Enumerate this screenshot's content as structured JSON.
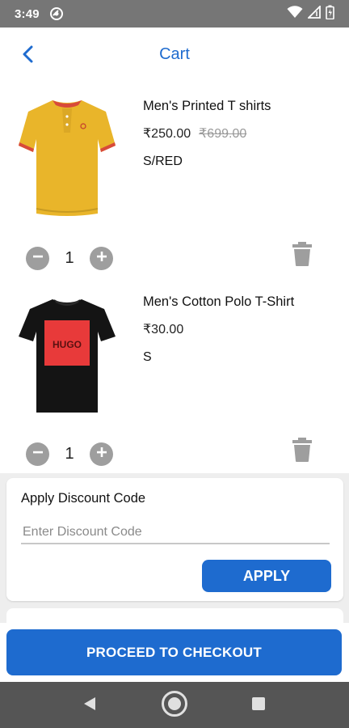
{
  "status_bar": {
    "time": "3:49",
    "icons": [
      "data-saver-icon",
      "wifi-icon",
      "signal-icon",
      "battery-icon"
    ]
  },
  "header": {
    "title": "Cart",
    "back_icon": "chevron-left-icon"
  },
  "cart": {
    "items": [
      {
        "name": "Men's Printed T shirts",
        "price": "₹250.00",
        "original_price": "₹699.00",
        "variant": "S/RED",
        "quantity": "1",
        "image": "yellow-polo-shirt"
      },
      {
        "name": "Men's Cotton Polo T-Shirt",
        "price": "₹30.00",
        "original_price": "",
        "variant": "S",
        "quantity": "1",
        "image": "black-hugo-tshirt",
        "image_text": "HUGO"
      }
    ]
  },
  "discount": {
    "title": "Apply Discount Code",
    "placeholder": "Enter Discount Code",
    "apply_label": "APPLY"
  },
  "checkout": {
    "label": "PROCEED TO CHECKOUT"
  },
  "colors": {
    "accent": "#1e6bcf",
    "status_bar": "#767676",
    "nav_bar": "#555555",
    "qty_button": "#9e9e9e"
  }
}
